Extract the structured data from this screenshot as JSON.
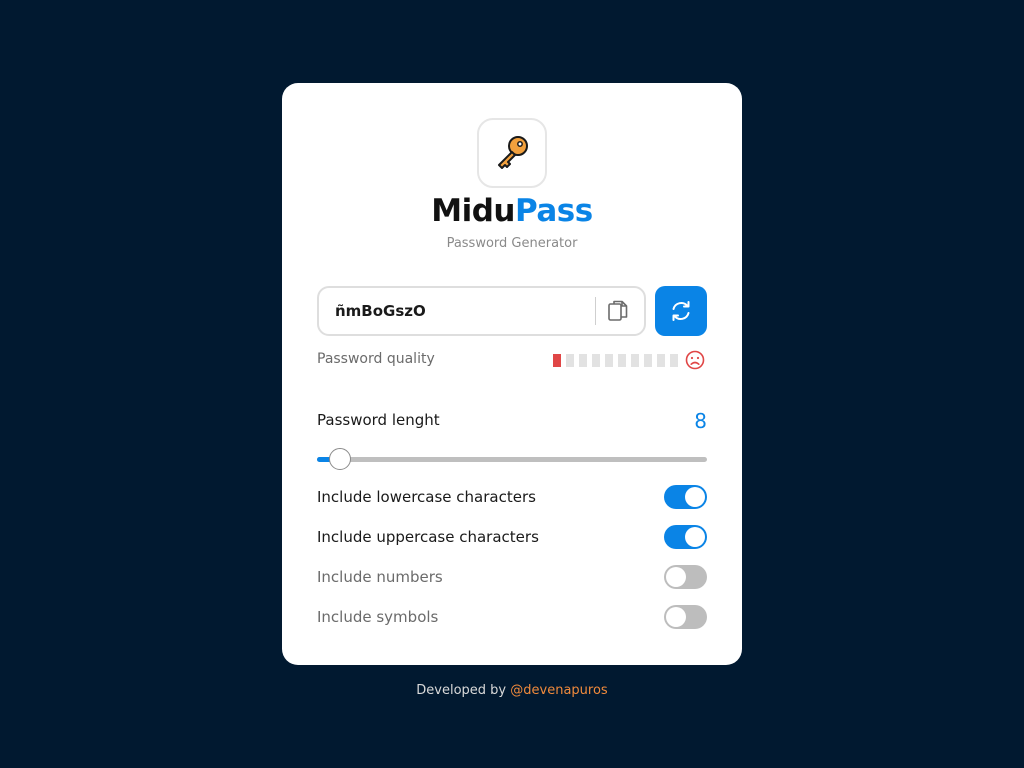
{
  "app": {
    "name_prefix": "Midu",
    "name_accent": "Pass",
    "subtitle": "Password Generator",
    "logo_icon": "key-icon"
  },
  "password": {
    "value": "ñmBoGszO",
    "copy_icon": "copy-icon",
    "regenerate_icon": "refresh-icon"
  },
  "quality": {
    "label": "Password quality",
    "segments_total": 10,
    "segments_filled": 1,
    "status_icon": "sad-face-icon"
  },
  "length": {
    "label": "Password lenght",
    "value": "8",
    "slider_fraction": 0.06
  },
  "options": [
    {
      "label": "Include lowercase characters",
      "enabled": true
    },
    {
      "label": "Include uppercase characters",
      "enabled": true
    },
    {
      "label": "Include numbers",
      "enabled": false
    },
    {
      "label": "Include symbols",
      "enabled": false
    }
  ],
  "footer": {
    "text": "Developed by",
    "link": "@devenapuros"
  },
  "colors": {
    "background": "#011930",
    "accent": "#0a84e6",
    "quality_bad": "#e04646",
    "footer_link": "#f08a3c"
  }
}
